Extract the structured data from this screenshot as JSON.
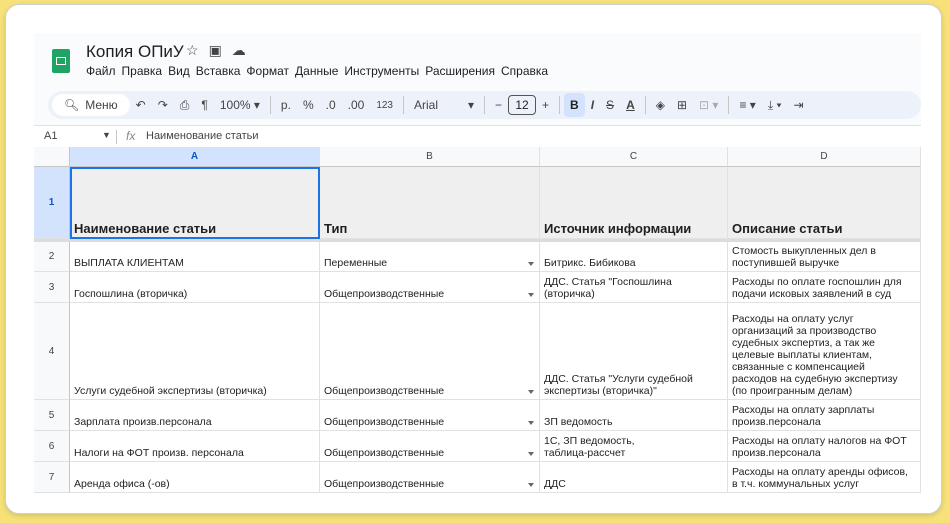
{
  "doc": {
    "title": "Копия ОПиУ",
    "icons": [
      "star-icon",
      "move-folder-icon",
      "cloud-status-icon"
    ]
  },
  "menu": [
    "Файл",
    "Правка",
    "Вид",
    "Вставка",
    "Формат",
    "Данные",
    "Инструменты",
    "Расширения",
    "Справка"
  ],
  "toolbar": {
    "search_label": "Меню",
    "zoom": "100%",
    "currency": "р.",
    "percent": "%",
    "dec_less": ".0",
    "dec_more": ".00",
    "number_format": "123",
    "font": "Arial",
    "font_size": "12",
    "minus": "−",
    "plus": "+",
    "bold": "B",
    "italic": "I",
    "strike": "S",
    "text_color": "A"
  },
  "formula_bar": {
    "cell_ref": "A1",
    "fx": "fx",
    "content": "Наименование статьи"
  },
  "columns": [
    "A",
    "B",
    "C",
    "D"
  ],
  "rows": [
    {
      "num": "1",
      "a": "Наименование статьи",
      "b": "Тип",
      "c": "Источник информации",
      "d": "Описание статьи"
    },
    {
      "num": "2",
      "a": "ВЫПЛАТА КЛИЕНТАМ",
      "b": "Переменные",
      "c": "Битрикс. Бибикова",
      "d": "Стомость выкупленных дел в\nпоступившей выручке"
    },
    {
      "num": "3",
      "a": "Госпошлина (вторичка)",
      "b": "Общепроизводственные",
      "c": "ДДС. Статья \"Госпошлина\n(вторичка)",
      "d": "Расходы по оплате госпошлин для\nподачи исковых заявлений в суд"
    },
    {
      "num": "4",
      "a": "Услуги судебной экспертизы (вторичка)",
      "b": "Общепроизводственные",
      "c": "ДДС. Статья \"Услуги судебной\nэкспертизы (вторичка)\"",
      "d": "Расходы на оплату услуг\nорганизаций за производство\nсудебных экспертиз, а так же\nцелевые выплаты клиентам,\nсвязанные с компенсацией\nрасходов на судебную экспертизу\n(по проигранным делам)"
    },
    {
      "num": "5",
      "a": "Зарплата произв.персонала",
      "b": "Общепроизводственные",
      "c": "ЗП ведомость",
      "d": "Расходы на оплату зарплаты\nпроизв.персонала"
    },
    {
      "num": "6",
      "a": "Налоги на ФОТ произв. персонала",
      "b": "Общепроизводственные",
      "c": "1С, ЗП ведомость,\nтаблица-рассчет",
      "d": "Расходы на оплату налогов на ФОТ\nпроизв.персонала"
    },
    {
      "num": "7",
      "a": "Аренда офиса (-ов)",
      "b": "Общепроизводственные",
      "c": "ДДС",
      "d": "Расходы на оплату аренды офисов,\nв т.ч. коммунальных услуг"
    }
  ]
}
